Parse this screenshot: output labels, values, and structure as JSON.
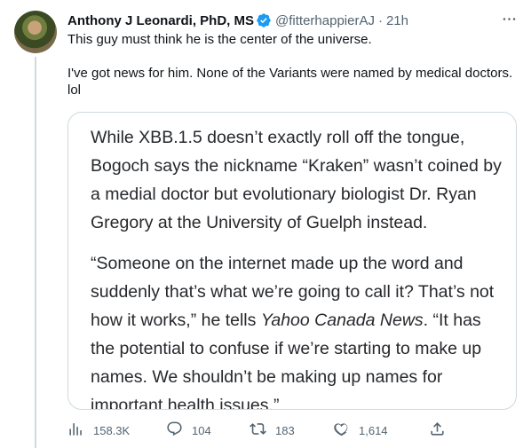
{
  "author": {
    "display_name": "Anthony J Leonardi, PhD, MS",
    "handle": "@fitterhappierAJ",
    "separator": "·",
    "time": "21h"
  },
  "tweet": {
    "paragraph1": "This guy must think he is the center of the universe.",
    "paragraph2": "I've got news for him. None of the Variants were named by medical doctors. lol"
  },
  "quote": {
    "paragraph1": "While XBB.1.5 doesn’t exactly roll off the tongue, Bogoch says the nickname “Kraken” wasn’t coined by a medial doctor but evolutionary biologist Dr. Ryan Gregory at the University of Guelph instead.",
    "paragraph2_before": "“Someone on the internet made up the word and suddenly that’s what we’re going to call it? That’s not how it works,” he tells ",
    "paragraph2_italic": "Yahoo Canada News",
    "paragraph2_after": ". “It has the potential to confuse if we’re starting to make up names. We shouldn’t be making up names for important health issues.”"
  },
  "actions": {
    "views": "158.3K",
    "replies": "104",
    "retweets": "183",
    "likes": "1,614"
  },
  "icons": {
    "verified": "verified-badge-icon",
    "more": "more-icon",
    "views": "analytics-icon",
    "reply": "reply-icon",
    "retweet": "retweet-icon",
    "like": "heart-icon",
    "share": "share-icon"
  },
  "colors": {
    "verified": "#1d9bf0",
    "secondary_text": "#536471",
    "border": "#cfd9de"
  }
}
